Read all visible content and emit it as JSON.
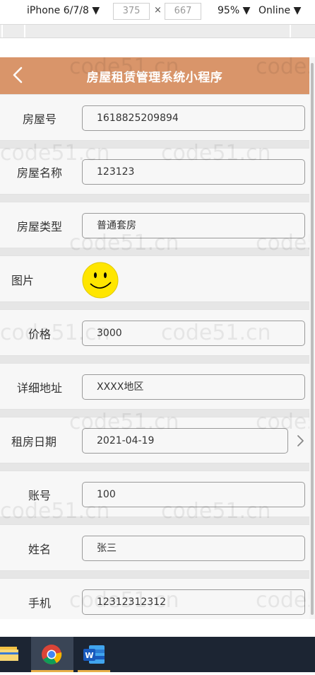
{
  "devtools": {
    "device": "iPhone 6/7/8 ▼",
    "width": "375",
    "times": "×",
    "height": "667",
    "zoom": "95% ▼",
    "network": "Online ▼"
  },
  "header": {
    "title": "房屋租赁管理系统小程序",
    "back_icon": "chevron-left-icon"
  },
  "form": {
    "fields": [
      {
        "label": "房屋号",
        "value": "1618825209894"
      },
      {
        "label": "房屋名称",
        "value": "123123"
      },
      {
        "label": "房屋类型",
        "value": "普通套房"
      },
      {
        "label": "图片",
        "image": "smiley-face-image"
      },
      {
        "label": "价格",
        "value": "3000"
      },
      {
        "label": "详细地址",
        "value": "XXXX地区"
      },
      {
        "label": "租房日期",
        "value": "2021-04-19",
        "picker": true
      },
      {
        "label": "账号",
        "value": "100"
      },
      {
        "label": "姓名",
        "value": "张三"
      },
      {
        "label": "手机",
        "value": "12312312312"
      }
    ]
  },
  "watermark": "code51.cn",
  "taskbar": {
    "items": [
      "file-explorer-icon",
      "chrome-icon",
      "word-icon"
    ]
  },
  "colors": {
    "header": "#d9956a",
    "taskbar": "#1c2533"
  }
}
